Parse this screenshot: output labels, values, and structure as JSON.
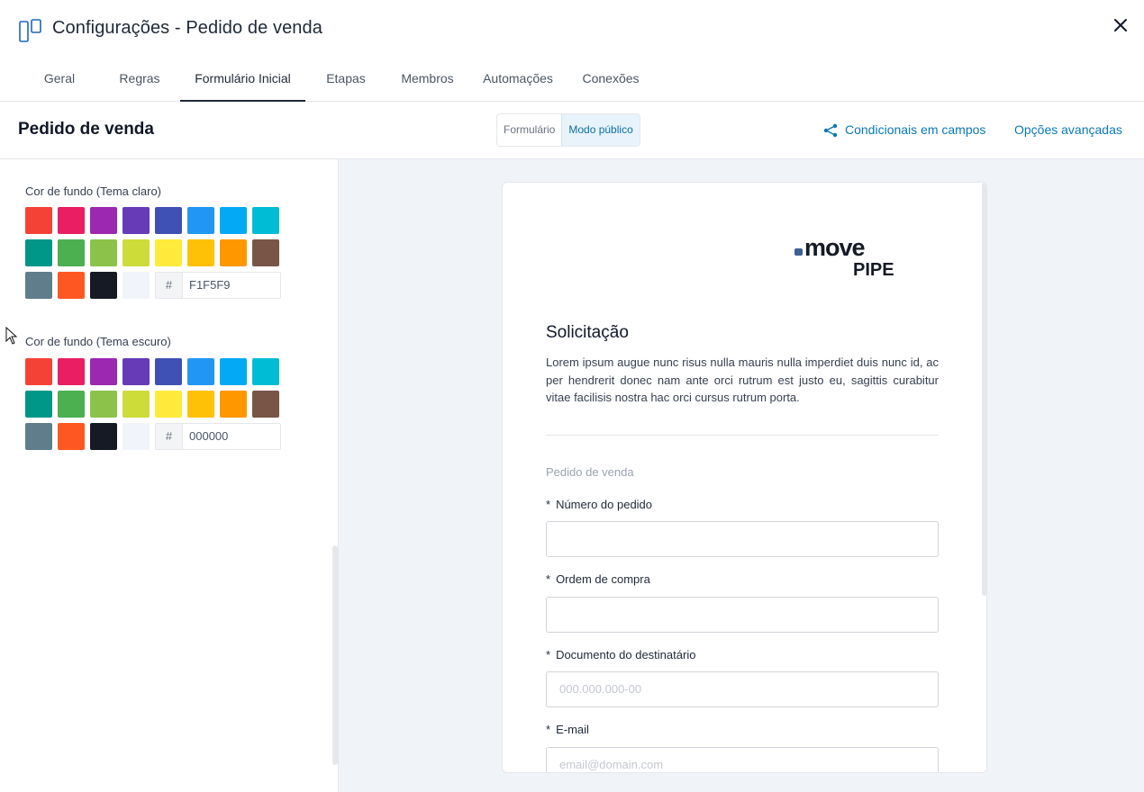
{
  "header": {
    "title": "Configurações - Pedido de venda"
  },
  "tabs": [
    {
      "label": "Geral"
    },
    {
      "label": "Regras"
    },
    {
      "label": "Formulário Inicial"
    },
    {
      "label": "Etapas"
    },
    {
      "label": "Membros"
    },
    {
      "label": "Automações"
    },
    {
      "label": "Conexões"
    }
  ],
  "active_tab": "Formulário Inicial",
  "subheader": {
    "title": "Pedido de venda",
    "mode_toggle": [
      "Formulário",
      "Modo público"
    ],
    "active_mode": "Modo público",
    "conditionals_link": "Condicionais em campos",
    "advanced_link": "Opções avançadas"
  },
  "palette": [
    "#f44336",
    "#e91e63",
    "#9c27b0",
    "#673ab7",
    "#3f51b5",
    "#2196f3",
    "#03a9f4",
    "#00bcd4",
    "#009688",
    "#4caf50",
    "#8bc34a",
    "#cddc39",
    "#ffeb3b",
    "#ffc107",
    "#ff9800",
    "#795548",
    "#607d8b",
    "#ff5722",
    "#151a24",
    "#f1f5f9"
  ],
  "light_theme": {
    "label": "Cor de fundo (Tema claro)",
    "hash": "#",
    "value": "F1F5F9"
  },
  "dark_theme": {
    "label": "Cor de fundo (Tema escuro)",
    "hash": "#",
    "value": "000000"
  },
  "form": {
    "logo_text_top": "move",
    "logo_text_bottom": "PIPE",
    "title": "Solicitação",
    "description": "Lorem ipsum augue nunc risus nulla mauris nulla imperdiet duis nunc id, ac per hendrerit donec nam ante orci rutrum est justo eu, sagittis curabitur vitae facilisis nostra hac orci cursus rutrum porta.",
    "section": "Pedido de venda",
    "required_mark": "*",
    "fields": [
      {
        "label": "Número do pedido",
        "placeholder": ""
      },
      {
        "label": "Ordem de compra",
        "placeholder": ""
      },
      {
        "label": "Documento do destinatário",
        "placeholder": "000.000.000-00"
      },
      {
        "label": "E-mail",
        "placeholder": "email@domain.com"
      }
    ]
  },
  "colors": {
    "accent": "#0b78b7",
    "preview_bg": "#f0f3f8"
  }
}
